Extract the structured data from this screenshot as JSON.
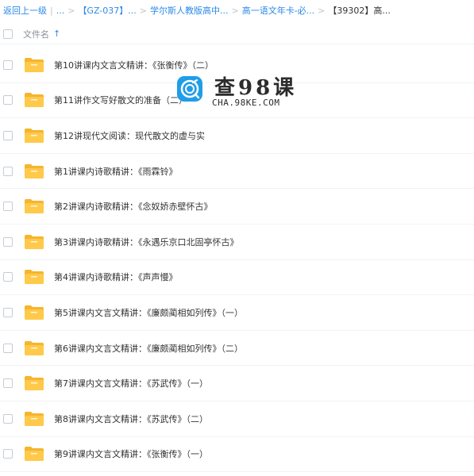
{
  "breadcrumb": {
    "back": "返回上一级",
    "ellipsis": "...",
    "items": [
      "【GZ-037】...",
      "学尔斯人教版高中...",
      "高一语文年卡-必...",
      "【39302】高..."
    ]
  },
  "header": {
    "column_name": "文件名",
    "sort_icon": "arrow-up-icon"
  },
  "folders": [
    "第10讲课内文言文精讲：《张衡传》（二）",
    "第11讲作文写好散文的准备（二）",
    "第12讲现代文阅读：现代散文的虚与实",
    "第1讲课内诗歌精讲：《雨霖铃》",
    "第2讲课内诗歌精讲：《念奴娇赤壁怀古》",
    "第3讲课内诗歌精讲：《永遇乐京口北固亭怀古》",
    "第4讲课内诗歌精讲：《声声慢》",
    "第5讲课内文言文精讲：《廉颇蔺相如列传》（一）",
    "第6讲课内文言文精讲：《廉颇蔺相如列传》（二）",
    "第7讲课内文言文精讲：《苏武传》（一）",
    "第8讲课内文言文精讲：《苏武传》（二）",
    "第9讲课内文言文精讲：《张衡传》（一）"
  ],
  "watermark": {
    "title": "查98课",
    "subtitle": "CHA.98KE.COM"
  },
  "colors": {
    "link": "#2c8ae8",
    "folder": "#ffc94a",
    "folder_dark": "#f5b52e",
    "text": "#333333"
  }
}
